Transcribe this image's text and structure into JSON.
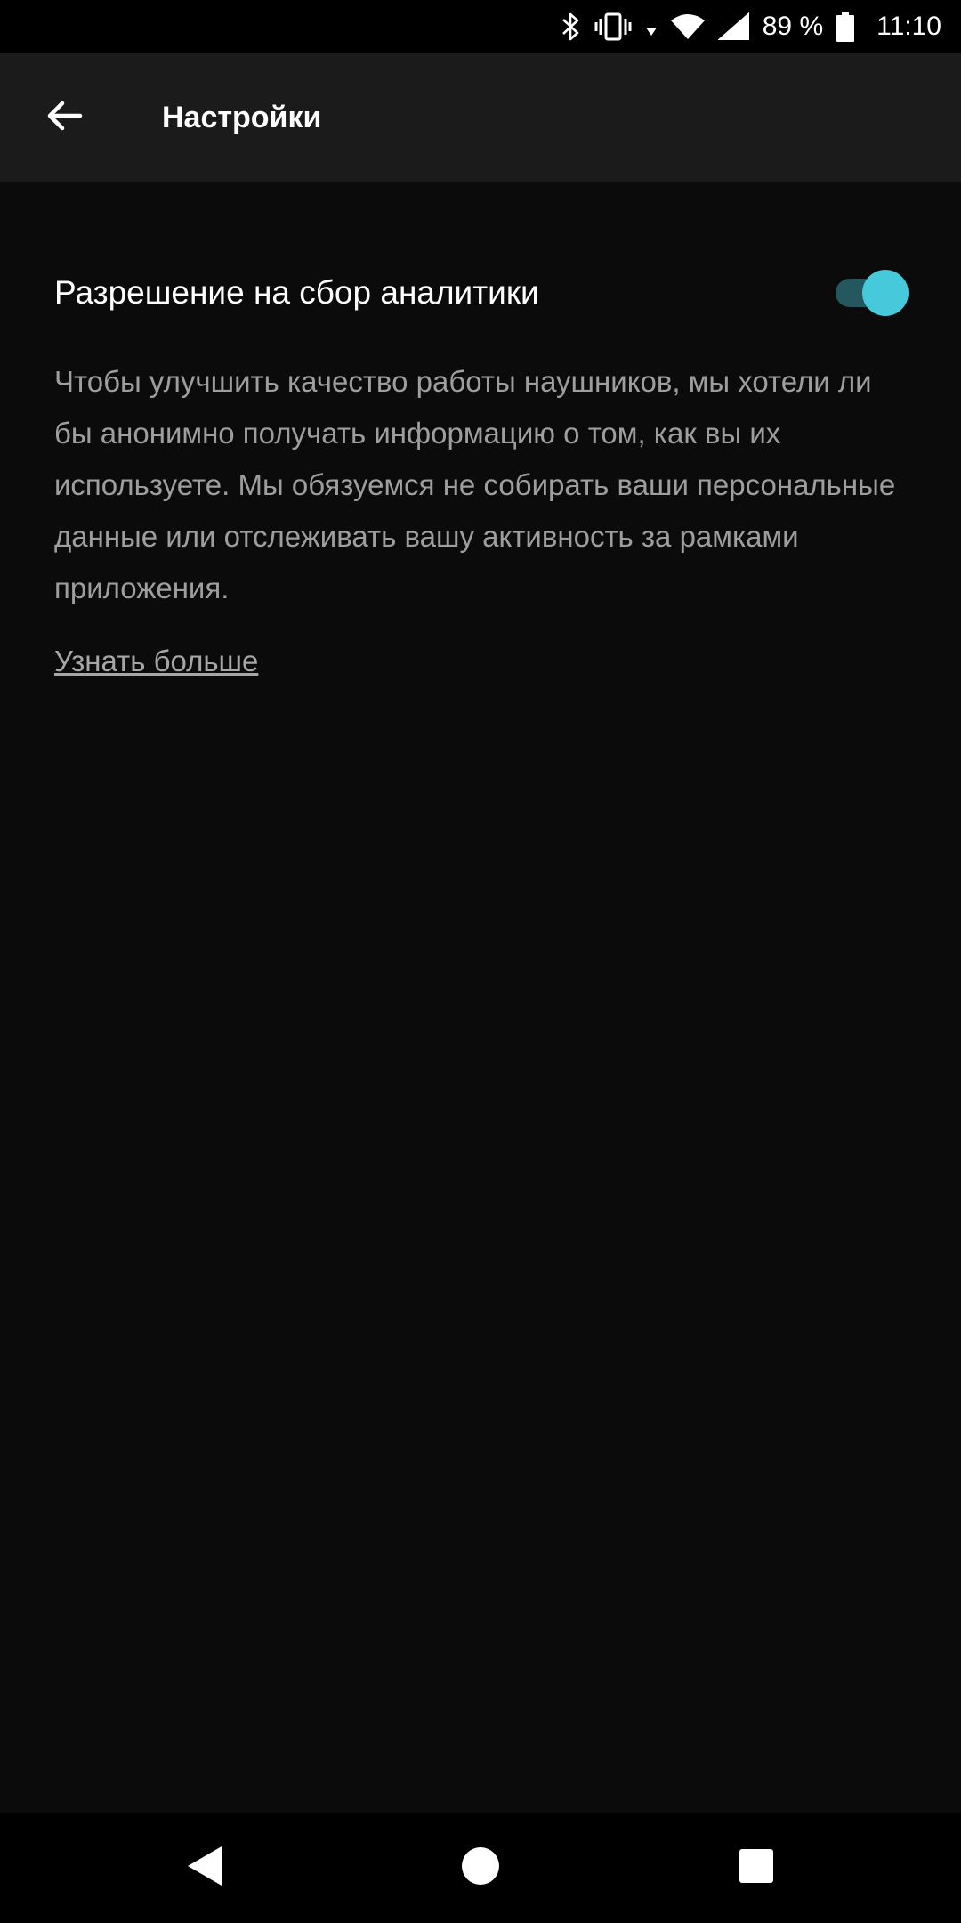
{
  "status_bar": {
    "battery_text": "89 %",
    "time": "11:10",
    "icons": [
      "bluetooth-icon",
      "vibrate-icon",
      "wifi-icon",
      "signal-icon",
      "battery-icon"
    ]
  },
  "app_bar": {
    "title": "Настройки",
    "back_icon": "arrow-left-icon"
  },
  "settings": {
    "analytics": {
      "title": "Разрешение на сбор аналитики",
      "enabled": true,
      "description": "Чтобы улучшить качество работы наушников, мы хотели ли бы анонимно получать информацию о том, как вы их используете. Мы обязуемся не собирать ваши персональные данные или отслеживать вашу активность за рамками приложения.",
      "learn_more": "Узнать больше"
    }
  },
  "colors": {
    "accent": "#45c9db",
    "accent_track": "#24585e",
    "app_bar_bg": "#1b1b1b",
    "content_bg": "#0b0b0b",
    "secondary_text": "#9e9e9e"
  },
  "nav_bar": {
    "icons": [
      "nav-back-icon",
      "nav-home-icon",
      "nav-recents-icon"
    ]
  }
}
